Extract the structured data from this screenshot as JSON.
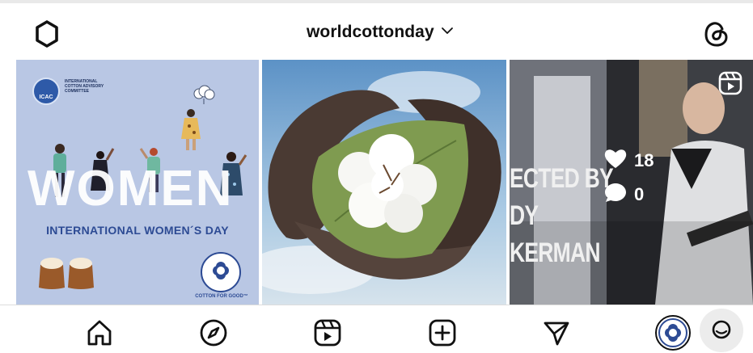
{
  "header": {
    "username": "worldcottonday",
    "settings_icon": "settings-icon",
    "threads_icon": "threads-icon",
    "dropdown_icon": "chevron-down-icon"
  },
  "posts": [
    {
      "type": "image",
      "logo_short": "ICAC",
      "logo_name": "International Cotton Advisory Committee",
      "headline": "WOMEN",
      "caption": "INTERNATIONAL WOMEN´S DAY",
      "seal_text": "COTTON FOR GOOD™"
    },
    {
      "type": "image",
      "description_icon": "cotton-boll-photo"
    },
    {
      "type": "reel",
      "film_lines": [
        "ECTED BY",
        "DY",
        "KERMAN"
      ],
      "likes": "18",
      "comments": "0",
      "badge_icon": "reels-icon"
    }
  ],
  "nav": {
    "items": [
      "home-icon",
      "explore-icon",
      "reels-icon",
      "create-icon",
      "direct-icon",
      "profile-avatar"
    ]
  },
  "colors": {
    "tile1_bg": "#b9c7e4",
    "brand_blue": "#2d4b94"
  }
}
